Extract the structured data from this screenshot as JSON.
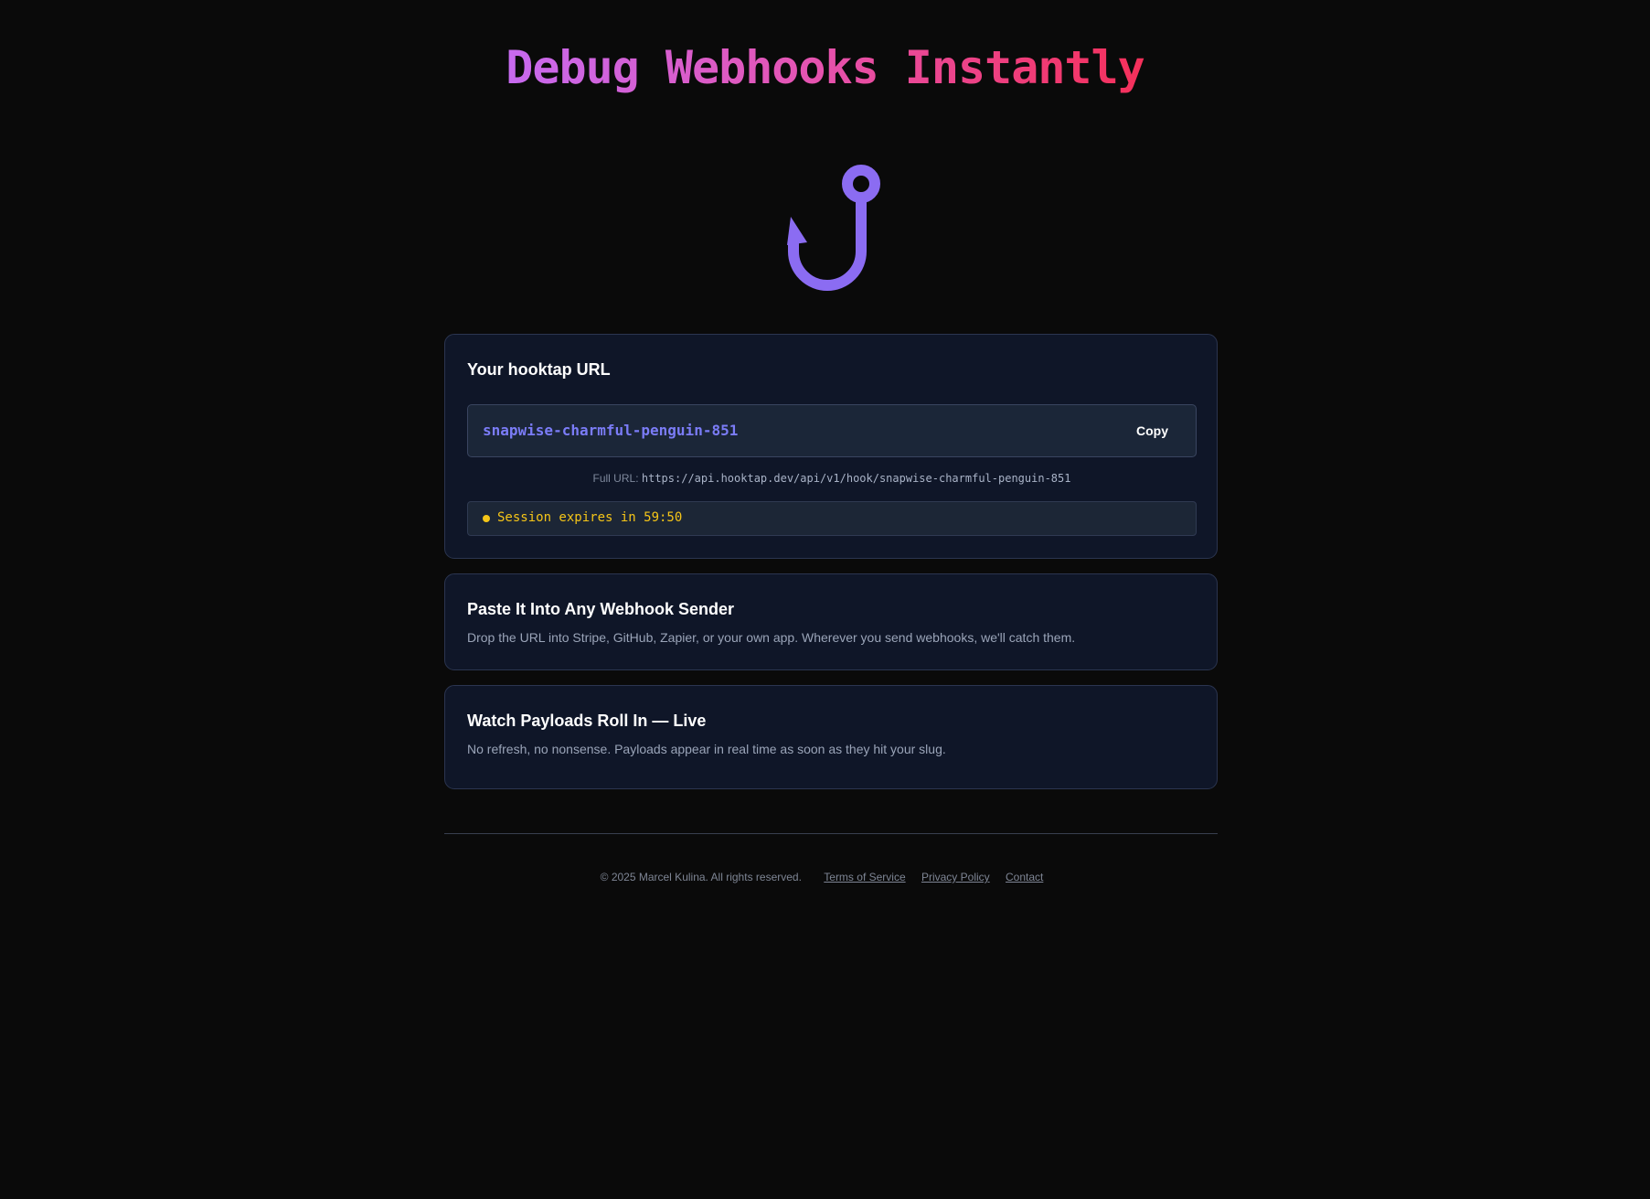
{
  "hero": {
    "title": "Debug Webhooks Instantly"
  },
  "logo": {
    "icon": "fish-hook-icon",
    "color": "#8b6cf2"
  },
  "url_card": {
    "title": "Your hooktap URL",
    "slug": "snapwise-charmful-penguin-851",
    "copy_label": "Copy",
    "full_url_label": "Full URL:",
    "full_url": "https://api.hooktap.dev/api/v1/hook/snapwise-charmful-penguin-851",
    "session_text": "Session expires in 59:50"
  },
  "feature_cards": [
    {
      "title": "Paste It Into Any Webhook Sender",
      "description": "Drop the URL into Stripe, GitHub, Zapier, or your own app. Wherever you send webhooks, we'll catch them."
    },
    {
      "title": "Watch Payloads Roll In — Live",
      "description": "No refresh, no nonsense. Payloads appear in real time as soon as they hit your slug."
    }
  ],
  "footer": {
    "copyright": "© 2025 Marcel Kulina. All rights reserved.",
    "links": [
      "Terms of Service",
      "Privacy Policy",
      "Contact"
    ]
  },
  "colors": {
    "background": "#0a0a0a",
    "card": "#0f1628",
    "accent_slug": "#7b7cf7",
    "session_warning": "#f5c518",
    "title_gradient_start": "#c76af0",
    "title_gradient_end": "#f5305a"
  }
}
